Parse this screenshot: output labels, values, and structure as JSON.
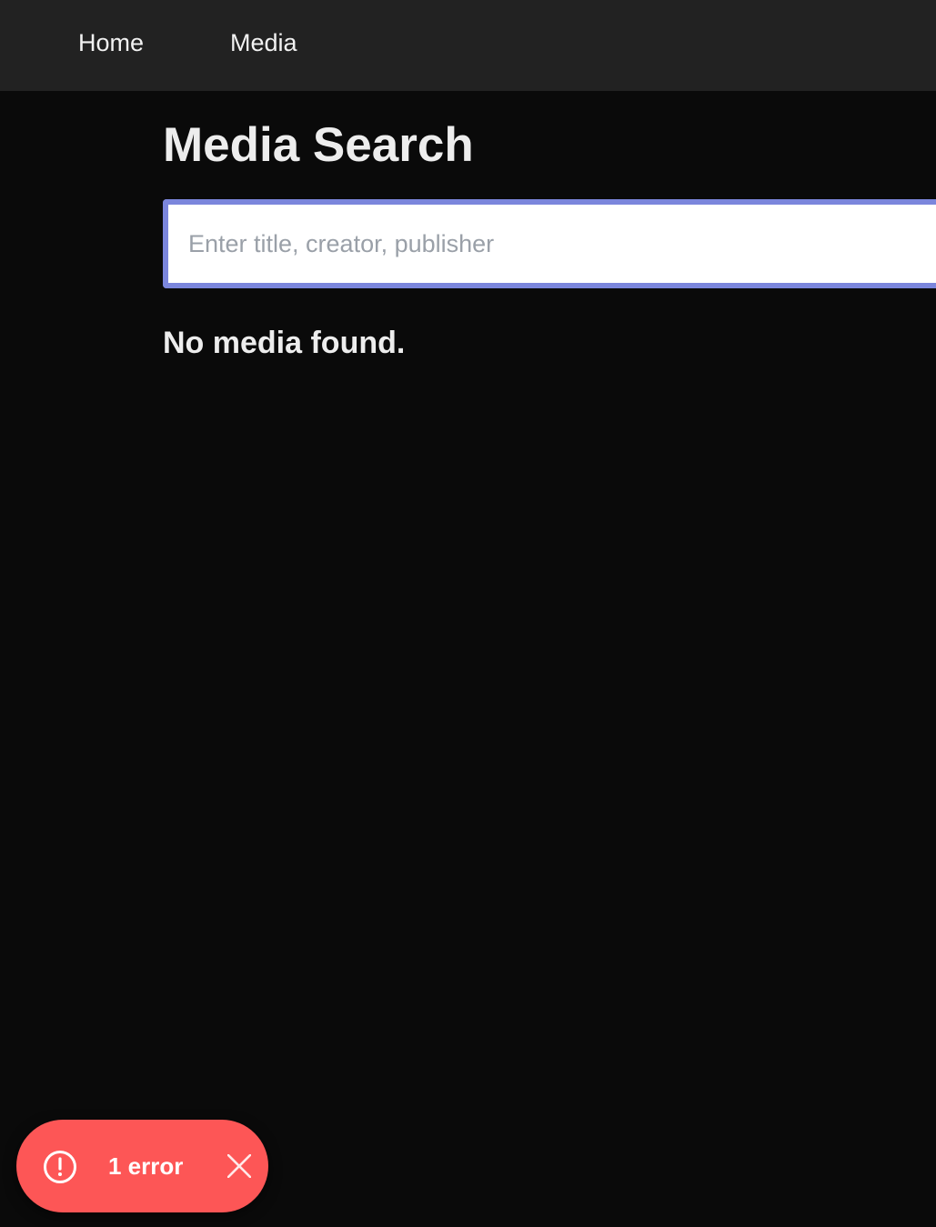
{
  "nav": {
    "home_label": "Home",
    "media_label": "Media"
  },
  "main": {
    "title": "Media Search",
    "search": {
      "placeholder": "Enter title, creator, publisher",
      "value": ""
    },
    "empty_message": "No media found."
  },
  "error_toast": {
    "label": "1 error",
    "icon": "alert-circle-icon",
    "close_icon": "close-icon",
    "color": "#fd5656"
  },
  "colors": {
    "background": "#0a0a0a",
    "navbar": "#222222",
    "input_focus_border": "#7b86dc"
  }
}
